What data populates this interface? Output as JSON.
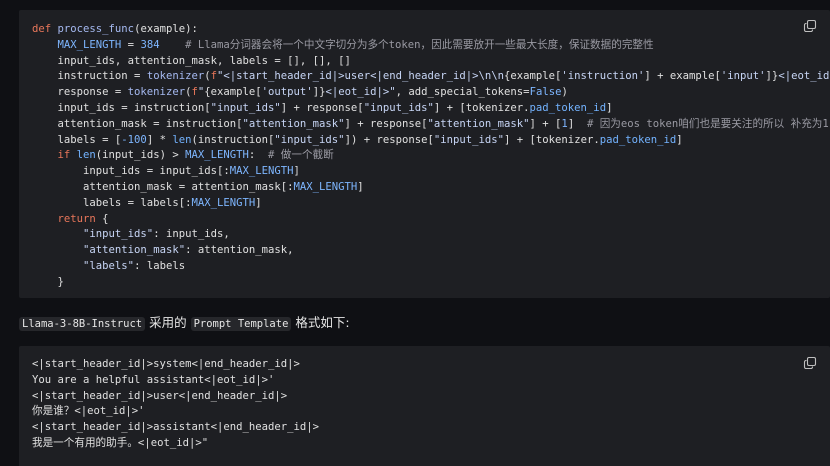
{
  "code_block_1": {
    "lines": [
      [
        [
          "kw",
          "def "
        ],
        [
          "fn",
          "process_func"
        ],
        [
          "plain",
          "(example):"
        ]
      ],
      [
        [
          "plain",
          "    "
        ],
        [
          "const",
          "MAX_LENGTH"
        ],
        [
          "plain",
          " = "
        ],
        [
          "const",
          "384"
        ],
        [
          "plain",
          "    "
        ],
        [
          "cm",
          "# Llama分词器会将一个中文字切分为多个token，因此需要放开一些最大长度，保证数据的完整性"
        ]
      ],
      [
        [
          "plain",
          "    input_ids, attention_mask, labels = [], [], []"
        ]
      ],
      [
        [
          "plain",
          "    instruction = "
        ],
        [
          "fn",
          "tokenizer"
        ],
        [
          "plain",
          "("
        ],
        [
          "kw",
          "f"
        ],
        [
          "str",
          "\"<|start_header_id|>user<|end_header_id|>\\n\\n"
        ],
        [
          "plain",
          "{example["
        ],
        [
          "str",
          "'instruction'"
        ],
        [
          "plain",
          "] + example["
        ],
        [
          "str",
          "'input'"
        ],
        [
          "plain",
          "]}"
        ],
        [
          "str",
          "<|eot_id|>"
        ]
      ],
      [
        [
          "plain",
          "    response = "
        ],
        [
          "fn",
          "tokenizer"
        ],
        [
          "plain",
          "("
        ],
        [
          "kw",
          "f"
        ],
        [
          "str",
          "\""
        ],
        [
          "plain",
          "{example["
        ],
        [
          "str",
          "'output'"
        ],
        [
          "plain",
          "]}"
        ],
        [
          "str",
          "<|eot_id|>\""
        ],
        [
          "plain",
          ", add_special_tokens="
        ],
        [
          "const",
          "False"
        ],
        [
          "plain",
          ")"
        ]
      ],
      [
        [
          "plain",
          "    input_ids = instruction["
        ],
        [
          "str",
          "\"input_ids\""
        ],
        [
          "plain",
          "] + response["
        ],
        [
          "str",
          "\"input_ids\""
        ],
        [
          "plain",
          "] + [tokenizer."
        ],
        [
          "bi",
          "pad_token_id"
        ],
        [
          "plain",
          "]"
        ]
      ],
      [
        [
          "plain",
          "    attention_mask = instruction["
        ],
        [
          "str",
          "\"attention_mask\""
        ],
        [
          "plain",
          "] + response["
        ],
        [
          "str",
          "\"attention_mask\""
        ],
        [
          "plain",
          "] + ["
        ],
        [
          "const",
          "1"
        ],
        [
          "plain",
          "]  "
        ],
        [
          "cm",
          "# 因为eos token咱们也是要关注的所以 补充为1"
        ]
      ],
      [
        [
          "plain",
          "    labels = ["
        ],
        [
          "const",
          "-100"
        ],
        [
          "plain",
          "] * "
        ],
        [
          "bi",
          "len"
        ],
        [
          "plain",
          "(instruction["
        ],
        [
          "str",
          "\"input_ids\""
        ],
        [
          "plain",
          "]) + response["
        ],
        [
          "str",
          "\"input_ids\""
        ],
        [
          "plain",
          "] + [tokenizer."
        ],
        [
          "bi",
          "pad_token_id"
        ],
        [
          "plain",
          "]"
        ]
      ],
      [
        [
          "plain",
          "    "
        ],
        [
          "kw",
          "if "
        ],
        [
          "bi",
          "len"
        ],
        [
          "plain",
          "(input_ids) > "
        ],
        [
          "const",
          "MAX_LENGTH"
        ],
        [
          "plain",
          ":  "
        ],
        [
          "cm",
          "# 做一个截断"
        ]
      ],
      [
        [
          "plain",
          "        input_ids = input_ids[:"
        ],
        [
          "const",
          "MAX_LENGTH"
        ],
        [
          "plain",
          "]"
        ]
      ],
      [
        [
          "plain",
          "        attention_mask = attention_mask[:"
        ],
        [
          "const",
          "MAX_LENGTH"
        ],
        [
          "plain",
          "]"
        ]
      ],
      [
        [
          "plain",
          "        labels = labels[:"
        ],
        [
          "const",
          "MAX_LENGTH"
        ],
        [
          "plain",
          "]"
        ]
      ],
      [
        [
          "plain",
          "    "
        ],
        [
          "kw",
          "return"
        ],
        [
          "plain",
          " {"
        ]
      ],
      [
        [
          "plain",
          "        "
        ],
        [
          "str",
          "\"input_ids\""
        ],
        [
          "plain",
          ": input_ids,"
        ]
      ],
      [
        [
          "plain",
          "        "
        ],
        [
          "str",
          "\"attention_mask\""
        ],
        [
          "plain",
          ": attention_mask,"
        ]
      ],
      [
        [
          "plain",
          "        "
        ],
        [
          "str",
          "\"labels\""
        ],
        [
          "plain",
          ": labels"
        ]
      ],
      [
        [
          "plain",
          "    }"
        ]
      ]
    ]
  },
  "paragraph": {
    "code1": "Llama-3-8B-Instruct",
    "text1": " 采用的 ",
    "code2": "Prompt Template",
    "text2": " 格式如下:"
  },
  "code_block_2": {
    "lines": [
      [
        [
          "plain",
          "<|start_header_id|>system<|end_header_id|>"
        ]
      ],
      [
        [
          "plain",
          "You are a helpful assistant<|eot_id|>'"
        ]
      ],
      [
        [
          "plain",
          "<|start_header_id|>user<|end_header_id|>"
        ]
      ],
      [
        [
          "plain",
          "你是谁？<|eot_id|>'"
        ]
      ],
      [
        [
          "plain",
          "<|start_header_id|>assistant<|end_header_id|>"
        ]
      ],
      [
        [
          "plain",
          "我是一个有用的助手。<|eot_id|>\""
        ]
      ]
    ]
  },
  "icons": {
    "copy": "copy-icon"
  },
  "colors": {
    "background": "#0f1014",
    "code_background": "#1e1f23",
    "keyword": "#e8765a",
    "function": "#a5b9f0",
    "constant": "#7eb6ff",
    "string": "#c7d5f5",
    "comment": "#9a9aa3"
  }
}
